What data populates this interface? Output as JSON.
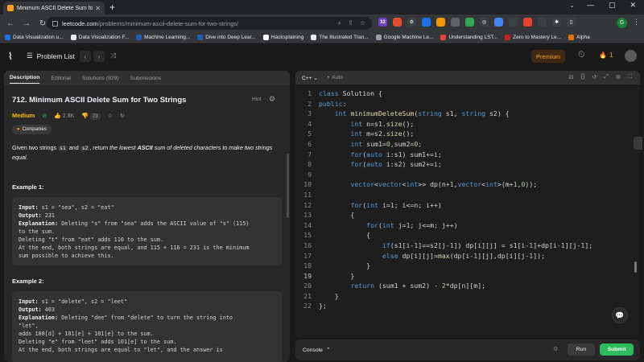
{
  "browser": {
    "tab_title": "Minimum ASCII Delete Sum for Tw",
    "url_host": "leetcode.com",
    "url_path": "/problems/minimum-ascii-delete-sum-for-two-strings/",
    "ext_badge": "32",
    "profile_initial": "G"
  },
  "bookmarks": [
    {
      "label": "Data Visualization u...",
      "color": "#1a73e8"
    },
    {
      "label": "Data Visualization F...",
      "color": "#e8eaed"
    },
    {
      "label": "Machine Learning...",
      "color": "#1a5fb4"
    },
    {
      "label": "Dive into Deep Lear...",
      "color": "#1a5fb4"
    },
    {
      "label": "Hacksplaining",
      "color": "#ffffff"
    },
    {
      "label": "The Illustrated Tran...",
      "color": "#e8eaed"
    },
    {
      "label": "Google Machine Le...",
      "color": "#9aa0a6"
    },
    {
      "label": "Understanding LST...",
      "color": "#ea4335"
    },
    {
      "label": "Zero to Mastery Le...",
      "color": "#c5221f"
    },
    {
      "label": "Alpha",
      "color": "#e8710a"
    }
  ],
  "lcnav": {
    "problem_list": "Problem List",
    "premium": "Premium",
    "streak": "1"
  },
  "left": {
    "tabs": [
      "Description",
      "Editorial",
      "Solutions (929)",
      "Submissions"
    ],
    "title": "712. Minimum ASCII Delete Sum for Two Strings",
    "hint": "Hint",
    "difficulty": "Medium",
    "likes": "2.8K",
    "dislikes": "73",
    "companies": "Companies",
    "desc_pre": "Given two strings ",
    "s1": "s1",
    "desc_and": " and ",
    "s2": "s2",
    "desc_mid": ", return ",
    "desc_em1": "the lowest ",
    "desc_ascii": "ASCII",
    "desc_em2": " sum of deleted characters to make two strings equal",
    "desc_end": ".",
    "example1_title": "Example 1:",
    "example1_lines": [
      {
        "bold": "Input:",
        "rest": " s1 = \"sea\", s2 = \"eat\""
      },
      {
        "bold": "Output:",
        "rest": " 231"
      },
      {
        "bold": "Explanation:",
        "rest": " Deleting \"s\" from \"sea\" adds the ASCII value of \"s\" (115)"
      },
      {
        "bold": "",
        "rest": "to the sum."
      },
      {
        "bold": "",
        "rest": "Deleting \"t\" from \"eat\" adds 116 to the sum."
      },
      {
        "bold": "",
        "rest": "At the end, both strings are equal, and 115 + 116 = 231 is the minimum"
      },
      {
        "bold": "",
        "rest": "sum possible to achieve this."
      }
    ],
    "example2_title": "Example 2:",
    "example2_lines": [
      {
        "bold": "Input:",
        "rest": " s1 = \"delete\", s2 = \"leet\""
      },
      {
        "bold": "Output:",
        "rest": " 403"
      },
      {
        "bold": "Explanation:",
        "rest": " Deleting \"dee\" from \"delete\" to turn the string into"
      },
      {
        "bold": "",
        "rest": "\"let\","
      },
      {
        "bold": "",
        "rest": "adds 100[d] + 101[e] + 101[e] to the sum."
      },
      {
        "bold": "",
        "rest": "Deleting \"e\" from \"leet\" adds 101[e] to the sum."
      },
      {
        "bold": "",
        "rest": "At the end, both strings are equal to \"let\", and the answer is"
      }
    ]
  },
  "editor": {
    "language": "C++",
    "mode": "Auto",
    "current_line": 19,
    "lines": [
      "class Solution {",
      "public:",
      "    int minimumDeleteSum(string s1, string s2) {",
      "        int n=s1.size();",
      "        int m=s2.size();",
      "        int sum1=0,sum2=0;",
      "        for(auto i:s1) sum1+=i;",
      "        for(auto i:s2) sum2+=i;",
      "",
      "        vector<vector<int>> dp(n+1,vector<int>(m+1,0));",
      "",
      "        for(int i=1; i<=n; i++)",
      "        {",
      "            for(int j=1; j<=m; j++)",
      "            {",
      "                if(s1[i-1]==s2[j-1]) dp[i][j] = s1[i-1]+dp[i-1][j-1];",
      "                else dp[i][j]=max(dp[i-1][j],dp[i][j-1]);",
      "            }",
      "        }",
      "        return (sum1 + sum2) - 2*dp[n][m];",
      "    }",
      "};"
    ]
  },
  "console": {
    "label": "Console",
    "run": "Run",
    "submit": "Submit"
  }
}
